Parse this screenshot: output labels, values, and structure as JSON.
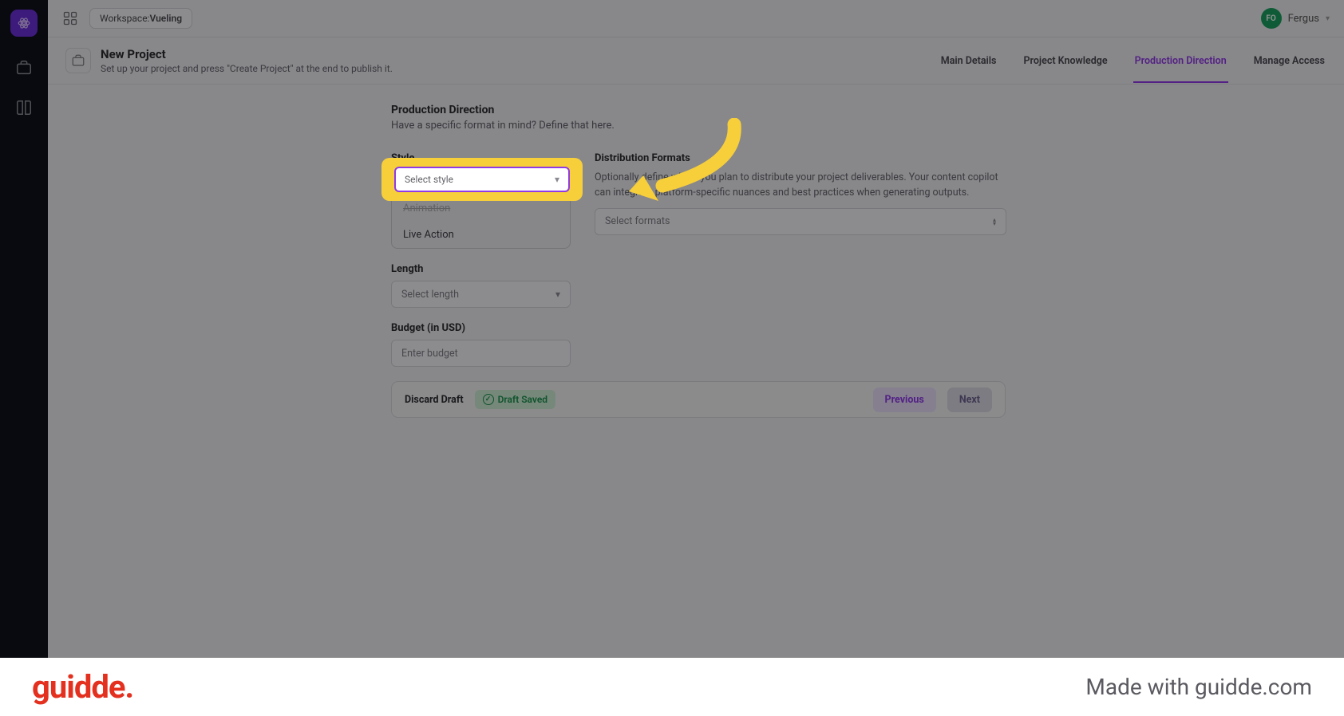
{
  "workspace": {
    "label": "Workspace:",
    "name": "Vueling"
  },
  "user": {
    "initials": "FO",
    "name": "Fergus"
  },
  "project": {
    "title": "New Project",
    "subtitle": "Set up your project and press \"Create Project\" at the end to publish it."
  },
  "tabs": {
    "main": "Main Details",
    "knowledge": "Project Knowledge",
    "production": "Production Direction",
    "access": "Manage Access"
  },
  "section": {
    "title": "Production Direction",
    "subtitle": "Have a specific format in mind? Define that here."
  },
  "style": {
    "label": "Style",
    "placeholder": "Select style",
    "opt_animation": "Animation",
    "opt_live": "Live Action"
  },
  "dist": {
    "label": "Distribution Formats",
    "desc": "Optionally define where you plan to distribute your project deliverables. Your content copilot can integrate platform-specific nuances and best practices when generating outputs.",
    "placeholder": "Select formats"
  },
  "length": {
    "label": "Length",
    "placeholder": "Select length"
  },
  "budget": {
    "label": "Budget (in USD)",
    "placeholder": "Enter budget"
  },
  "footer": {
    "discard": "Discard Draft",
    "saved": "Draft Saved",
    "previous": "Previous",
    "next": "Next"
  },
  "guidde": {
    "brand": "guidde.",
    "made": "Made with guidde.com"
  }
}
